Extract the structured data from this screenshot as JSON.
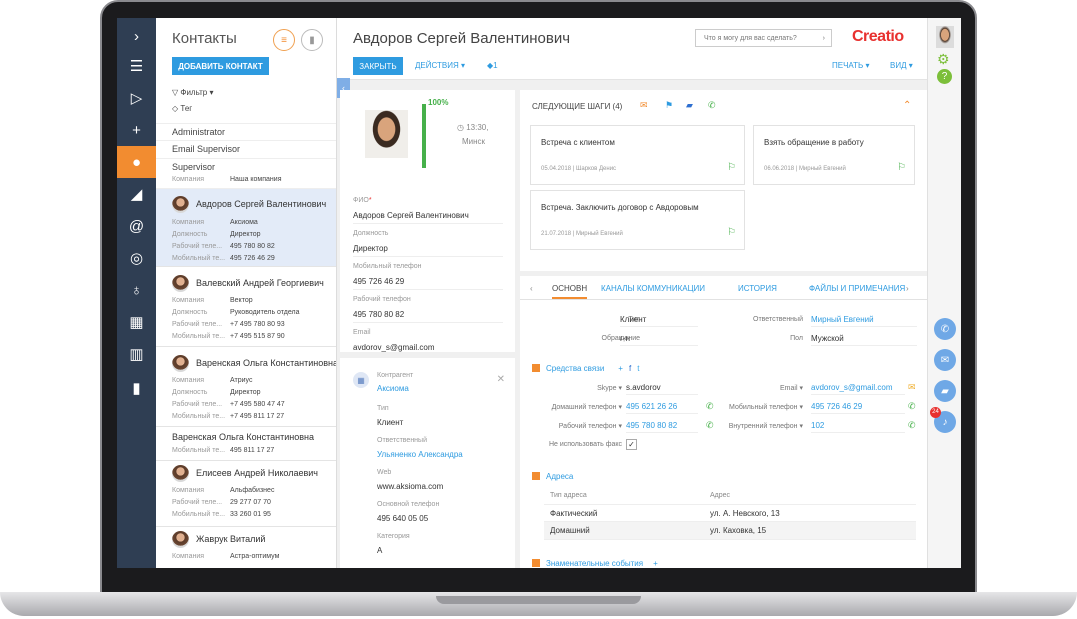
{
  "list": {
    "title": "Контакты",
    "add_button": "ДОБАВИТЬ КОНТАКТ",
    "filter": "Фильтр",
    "tag": "Тег",
    "groups": [
      "Administrator",
      "Email Supervisor",
      "Supervisor"
    ],
    "supervisor_company_label": "Компания",
    "supervisor_company_value": "Наша компания",
    "contacts": [
      {
        "name": "Авдоров Сергей Валентинович",
        "rows": [
          [
            "Компания",
            "Аксиома"
          ],
          [
            "Должность",
            "Директор"
          ],
          [
            "Рабочий теле...",
            "495 780 80 82"
          ],
          [
            "Мобильный те...",
            "495 726 46 29"
          ]
        ]
      },
      {
        "name": "Валевский Андрей Георгиевич",
        "rows": [
          [
            "Компания",
            "Вектор"
          ],
          [
            "Должность",
            "Руководитель отдела"
          ],
          [
            "Рабочий теле...",
            "+7 495 780 80 93"
          ],
          [
            "Мобильный те...",
            "+7 495 515 87 90"
          ]
        ]
      },
      {
        "name": "Варенская Ольга Константиновна",
        "rows": [
          [
            "Компания",
            "Атриус"
          ],
          [
            "Должность",
            "Директор"
          ],
          [
            "Рабочий теле...",
            "+7 495 580 47 47"
          ],
          [
            "Мобильный те...",
            "+7 495 811 17 27"
          ]
        ]
      },
      {
        "name": "Варенская Ольга Константиновна",
        "rows": [
          [
            "Мобильный те...",
            "495 811 17 27"
          ]
        ]
      },
      {
        "name": "Елисеев Андрей Николаевич",
        "rows": [
          [
            "Компания",
            "Альфабизнес"
          ],
          [
            "Рабочий теле...",
            "29 277 07 70"
          ],
          [
            "Мобильный те...",
            "33 260 01 95"
          ]
        ]
      },
      {
        "name": "Жаврук Виталий",
        "rows": [
          [
            "Компания",
            "Астра-оптимум"
          ]
        ]
      }
    ]
  },
  "header": {
    "name": "Авдоров Сергей Валентинович",
    "close": "ЗАКРЫТЬ",
    "actions": "ДЕЙСТВИЯ",
    "tag_count": "1",
    "search_placeholder": "Что я могу для вас сделать?",
    "logo": "Creatio",
    "print": "ПЕЧАТЬ",
    "view": "ВИД"
  },
  "profile": {
    "completeness": "100%",
    "completeness_value": 1.0,
    "time": "13:30,",
    "city": "Минск",
    "fields": [
      {
        "label": "ФИО",
        "value": "Авдоров Сергей Валентинович"
      },
      {
        "label": "Должность",
        "value": "Директор"
      },
      {
        "label": "Мобильный телефон",
        "value": "495 726 46 29"
      },
      {
        "label": "Рабочий телефон",
        "value": "495 780 80 82"
      },
      {
        "label": "Email",
        "value": "avdorov_s@gmail.com"
      }
    ]
  },
  "company": {
    "label": "Контрагент",
    "name": "Аксиома",
    "fields": [
      {
        "label": "Тип",
        "value": "Клиент",
        "link": false
      },
      {
        "label": "Ответственный",
        "value": "Ульяненко Александра",
        "link": true
      },
      {
        "label": "Web",
        "value": "www.aksioma.com",
        "link": false
      },
      {
        "label": "Основной телефон",
        "value": "495 640 05 05",
        "link": false
      },
      {
        "label": "Категория",
        "value": "А",
        "link": false
      }
    ]
  },
  "steps": {
    "title": "СЛЕДУЮЩИЕ ШАГИ (4)",
    "items": [
      {
        "title": "Встреча с клиентом",
        "date": "05.04.2018",
        "owner": "Шарков Денис"
      },
      {
        "title": "Взять обращение в работу",
        "date": "06.06.2018",
        "owner": "Мирный Евгений"
      },
      {
        "title": "Встреча. Заключить договор с Авдоровым",
        "date": "21.07.2018",
        "owner": "Мирный Евгений"
      }
    ]
  },
  "tabs": [
    "ОСНОВН",
    "КАНАЛЫ КОММУНИКАЦИИ",
    "ИСТОРИЯ",
    "ФАЙЛЫ И ПРИМЕЧАНИЯ"
  ],
  "main": {
    "type_label": "Тип",
    "type_value": "Клиент",
    "owner_label": "Ответственный",
    "owner_value": "Мирный Евгений",
    "appeal_label": "Обращение",
    "appeal_value": "г-н",
    "gender_label": "Пол",
    "gender_value": "Мужской",
    "comm_section": "Средства связи",
    "skype_label": "Skype",
    "skype_value": "s.avdorov",
    "email_label": "Email",
    "email_value": "avdorov_s@gmail.com",
    "home_label": "Домашний телефон",
    "home_value": "495 621 26 26",
    "mobile_label": "Мобильный телефон",
    "mobile_value": "495 726 46 29",
    "work_label": "Рабочий телефон",
    "work_value": "495 780 80 82",
    "internal_label": "Внутренний телефон",
    "internal_value": "102",
    "nofax_label": "Не использовать факс",
    "addr_section": "Адреса",
    "addr_col1": "Тип адреса",
    "addr_col2": "Адрес",
    "addresses": [
      [
        "Фактический",
        "ул. А. Невского, 13"
      ],
      [
        "Домашний",
        "ул. Каховка, 15"
      ]
    ],
    "events_section": "Знаменательные события"
  },
  "notification_count": "24"
}
